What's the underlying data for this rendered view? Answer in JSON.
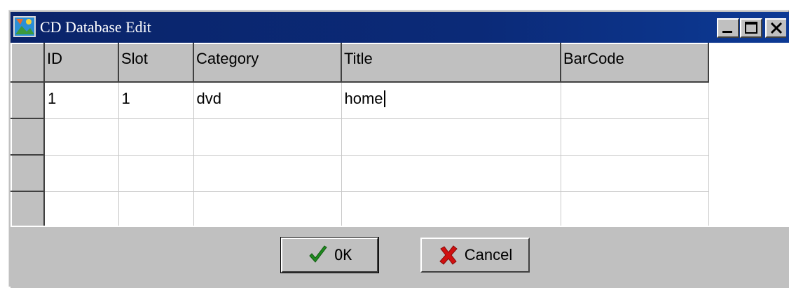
{
  "window": {
    "title": "CD Database Edit",
    "controls": {
      "minimize": "minimize",
      "maximize": "maximize",
      "close": "close"
    }
  },
  "grid": {
    "columns": [
      "ID",
      "Slot",
      "Category",
      "Title",
      "BarCode"
    ],
    "rows": [
      [
        "1",
        "1",
        "dvd",
        "home",
        ""
      ],
      [
        "",
        "",
        "",
        "",
        ""
      ],
      [
        "",
        "",
        "",
        "",
        ""
      ],
      [
        "",
        "",
        "",
        "",
        ""
      ]
    ]
  },
  "buttons": {
    "ok_label": "OK",
    "cancel_label": "Cancel"
  },
  "icons": {
    "app": "cd-database-icon",
    "ok": "checkmark-icon",
    "cancel": "red-x-icon"
  },
  "colors": {
    "titlebar": "#0a246a",
    "face": "#c0c0c0",
    "checkmark": "#1f8a1f",
    "cancel_x": "#d01010"
  }
}
